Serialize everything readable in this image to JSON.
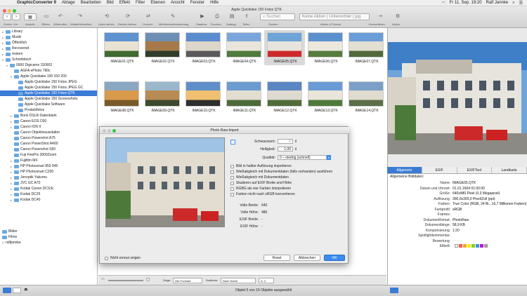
{
  "menubar": {
    "app": "GraphicConverter 9",
    "menus": [
      "Ablage",
      "Bearbeiten",
      "Bild",
      "Effekt",
      "Filter",
      "Ebenen",
      "Ansicht",
      "Fenster",
      "Hilfe"
    ],
    "clock": "Fr 11. Sep. 19:20",
    "user": "Ralf Jannke"
  },
  "toolbar": {
    "window_title": "Apple Quicktake 150 Fotos QTK",
    "labels": [
      "Zurück",
      "Vor",
      "Ansicht",
      "Öffnen",
      "Widerrufen",
      "Wiederherstellen",
      "Links drehen",
      "Rechts drehen",
      "Convert",
      "Mehrfachumbenennung",
      "Diashow",
      "Drucken",
      "Katalog",
      "Teilen",
      "Suchen",
      "Aktion & Format",
      "Konvertieren",
      "Aktion"
    ],
    "search_placeholder": "Suchen",
    "action_select": "Keine Aktion | Unterordner | jpg"
  },
  "sidebar": {
    "items": [
      {
        "label": "Library",
        "indent": 1,
        "tri": "▸"
      },
      {
        "label": "Musik",
        "indent": 1,
        "tri": "▸"
      },
      {
        "label": "Öffentlich",
        "indent": 1,
        "tri": "▸"
      },
      {
        "label": "Recovered",
        "indent": 1,
        "tri": "▸"
      },
      {
        "label": "restore",
        "indent": 1,
        "tri": "▸"
      },
      {
        "label": "Schreibtisch",
        "indent": 1,
        "tri": "▾"
      },
      {
        "label": "0000 Digicams 150902",
        "indent": 2,
        "tri": "▾"
      },
      {
        "label": "AGFA ePhoto 780c",
        "indent": 3,
        "tri": ""
      },
      {
        "label": "Apple Quicktake 100 150 200",
        "indent": 3,
        "tri": "▾"
      },
      {
        "label": "Apple Quicktake 150 Fotos JPEG",
        "indent": 4,
        "tri": ""
      },
      {
        "label": "Apple Quicktake 150 Fotos JPEG GC",
        "indent": 4,
        "tri": ""
      },
      {
        "label": "Apple Quicktake 150 Fotos QTK",
        "indent": 4,
        "tri": "",
        "selected": true
      },
      {
        "label": "Apple Quicktake 150 Screenshots",
        "indent": 4,
        "tri": ""
      },
      {
        "label": "Apple Quicktake Software",
        "indent": 4,
        "tri": ""
      },
      {
        "label": "Produktfotos",
        "indent": 4,
        "tri": ""
      },
      {
        "label": "Boris DSLR Datenbank",
        "indent": 3,
        "tri": "▸"
      },
      {
        "label": "Canon EOS D30",
        "indent": 3,
        "tri": "▸"
      },
      {
        "label": "Canon ION II",
        "indent": 3,
        "tri": "▸"
      },
      {
        "label": "Canon Objektivausstatter",
        "indent": 3,
        "tri": ""
      },
      {
        "label": "Canon Powershot A75",
        "indent": 3,
        "tri": ""
      },
      {
        "label": "Canon PowerShot A400",
        "indent": 3,
        "tri": ""
      },
      {
        "label": "Canon Powershot S60",
        "indent": 3,
        "tri": ""
      },
      {
        "label": "Fuji FinePix 2800Zoom",
        "indent": 3,
        "tri": ""
      },
      {
        "label": "Fujifilm MX",
        "indent": 3,
        "tri": "▸"
      },
      {
        "label": "HP Photosmart 850 945",
        "indent": 3,
        "tri": "▸"
      },
      {
        "label": "HP Photosmart C200",
        "indent": 3,
        "tri": "▸"
      },
      {
        "label": "Jenoptik Yakumo",
        "indent": 3,
        "tri": "▸"
      },
      {
        "label": "JVC GC A70",
        "indent": 3,
        "tri": "▸"
      },
      {
        "label": "Kodak Canon DCS3c",
        "indent": 3,
        "tri": "▸"
      },
      {
        "label": "Kodak DC25",
        "indent": 3,
        "tri": "▸"
      },
      {
        "label": "Kodak DC40",
        "indent": 3,
        "tri": "▸"
      }
    ],
    "volumes": [
      "Bilder",
      "Filme",
      "ralfjannke"
    ]
  },
  "grid": {
    "row1": [
      "IMAGE01.QTK",
      "IMAGE02.QTK",
      "IMAGE03.QTK",
      "IMAGE04.QTK",
      "IMAGE05.QTK",
      "IMAGE06.QTK",
      "IMAGE07.QTK"
    ],
    "row2": [
      "IMAGE08.QTK",
      "IMAGE09.QTK",
      "IMAGE10.QTK",
      "IMAGE11.QTK",
      "IMAGE12.QTK",
      "IMAGE13.QTK",
      "IMAGE14.QTK"
    ],
    "selected_index": 4,
    "bottom": {
      "zeige_label": "Zeige:",
      "zeige_value": "Alle Formate",
      "sortieren_label": "Sortieren:",
      "sortieren_value": "Nach Name",
      "order_value": "A..Z"
    }
  },
  "dialog": {
    "title": "Photo Raw-Import",
    "schwarzwert_label": "Schwarzwert:",
    "schwarzwert_value": "0",
    "helligkeit_label": "Helligkeit:",
    "helligkeit_value": "1,00",
    "qualitaet_label": "Qualität:",
    "qualitaet_value": "0 – niedrig (schnell)",
    "options": [
      "Bild in halber Auflösung importieren",
      "Weißabgleich mit Dokumentdaten (falls vorhanden) ausführen",
      "Weißabgleich mit Dokumentdaten",
      "Skalieren auf EXIF Breite und Höhe",
      "RGBG als vier Farben interpolieren",
      "Farben nicht nach sRGB konvertieren"
    ],
    "volle_breite_label": "Volle Breite:",
    "volle_breite": "640",
    "volle_hoehe_label": "Volle Höhe:",
    "volle_hoehe": "480",
    "exif_breite_label": "EXIF Breite:",
    "exif_breite": "-",
    "exif_hoehe_label": "EXIF Höhe:",
    "exif_hoehe": "-",
    "nicht_erneut": "Nicht erneut zeigen",
    "reset": "Reset",
    "abbrechen": "Abbrechen",
    "ok": "OK"
  },
  "info": {
    "tabs": [
      "Allgemein",
      "EXIF",
      "EXIFTool",
      "Landkarte"
    ],
    "section": "Allgemeine Bilddaten:",
    "rows": [
      {
        "k": "Name:",
        "v": "IMAGE05.QTK"
      },
      {
        "k": "Datum und Uhrzeit:",
        "v": "01.01.1904 01:00:00"
      },
      {
        "k": "Größe:",
        "v": "640x480 Pixel (0,3 Megapixel)"
      },
      {
        "k": "Auflösung:",
        "v": "300,0x300,0 Pixel/Zoll (ppi)"
      },
      {
        "k": "Farben:",
        "v": "True Color (RGB, 24 Bi...16,7 Millionen Farben)"
      },
      {
        "k": "Farbprofil:",
        "v": "sRGB"
      },
      {
        "k": "Frames:",
        "v": ""
      },
      {
        "k": "Dokumentformat:",
        "v": "PhotoRaw"
      },
      {
        "k": "Dokumentlänge:",
        "v": "58,9 KB"
      },
      {
        "k": "Komprimierung:",
        "v": "1:20"
      },
      {
        "k": "Spotlightkommentar:",
        "v": ""
      },
      {
        "k": "Bewertung:",
        "v": "· · · · ·"
      },
      {
        "k": "Etikett:",
        "v": ""
      }
    ]
  },
  "status": {
    "text": "Objekt 5 von 15 Objekte ausgewählt"
  },
  "colors": {
    "selection": "#3a7bd5",
    "folder": "#6aa9e0",
    "ok_button": "#3a8cf0"
  }
}
